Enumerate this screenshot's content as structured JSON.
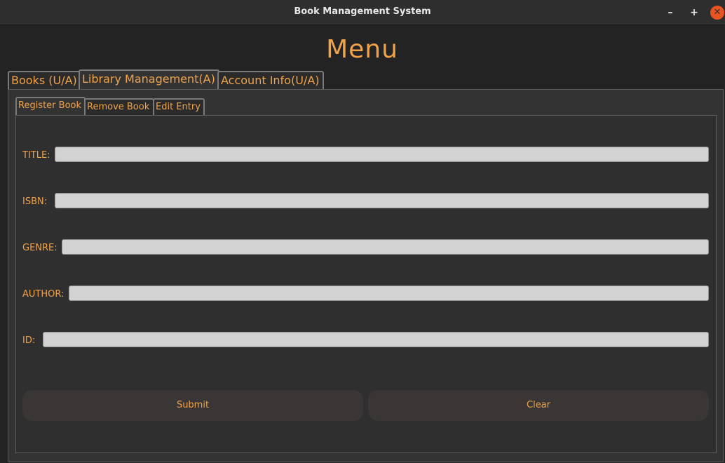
{
  "window": {
    "title": "Book Management System",
    "minimize_label": "–",
    "maximize_label": "+",
    "close_label": "✕"
  },
  "main": {
    "heading": "Menu",
    "tabs": [
      {
        "label": "Books (U/A)"
      },
      {
        "label": "Library Management(A)"
      },
      {
        "label": "Account Info(U/A)"
      }
    ],
    "active_tab": "Library Management(A)"
  },
  "library_management": {
    "subtabs": [
      {
        "label": "Register Book"
      },
      {
        "label": "Remove Book"
      },
      {
        "label": "Edit Entry"
      }
    ],
    "active_subtab": "Register Book",
    "form": {
      "fields": [
        {
          "label": "TITLE:",
          "value": ""
        },
        {
          "label": "ISBN:",
          "value": ""
        },
        {
          "label": "GENRE:",
          "value": ""
        },
        {
          "label": "AUTHOR:",
          "value": ""
        },
        {
          "label": "ID:",
          "value": ""
        }
      ],
      "submit_label": "Submit",
      "clear_label": "Clear"
    }
  },
  "colors": {
    "accent": "#f0a34a",
    "window_bg": "#232323",
    "panel_bg": "#333333",
    "input_bg": "#d2d2d2",
    "close_button": "#e95420"
  }
}
